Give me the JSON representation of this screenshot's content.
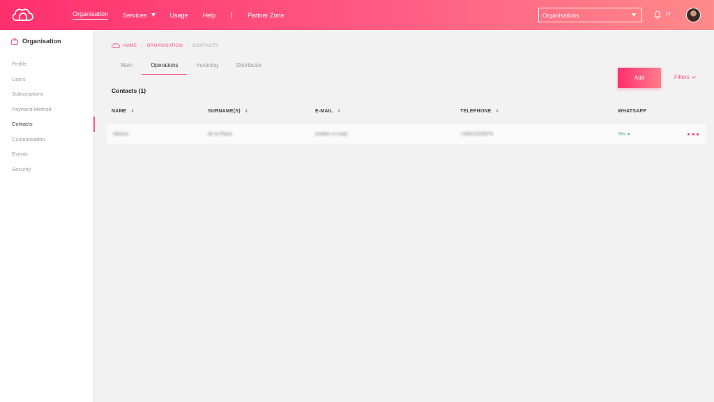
{
  "header": {
    "nav": [
      {
        "label": "Organisation",
        "active": true
      },
      {
        "label": "Services",
        "dropdown": true
      },
      {
        "label": "Usage"
      },
      {
        "label": "Help"
      },
      {
        "label": "Partner Zone"
      }
    ],
    "org_select": "Organisations",
    "notifications_count": "12"
  },
  "sidebar": {
    "title": "Organisation",
    "items": [
      "Profile",
      "Users",
      "Subscriptions",
      "Payment Method",
      "Contacts",
      "Customisation",
      "Events",
      "Security"
    ],
    "active_index": 4
  },
  "breadcrumb": {
    "home": "HOME",
    "section": "ORGANISATION",
    "current": "CONTACTS"
  },
  "tabs": [
    "Main",
    "Operations",
    "Invoicing",
    "Distributor"
  ],
  "active_tab": 1,
  "actions": {
    "add_label": "Add",
    "filters_label": "Filters"
  },
  "contacts": {
    "title": "Contacts (1)",
    "columns": [
      "NAME",
      "SURNAME(S)",
      "E-MAIL",
      "TELEPHONE",
      "WHATSAPP"
    ],
    "rows": [
      {
        "name": "Alberto",
        "surname": "de la Plaza",
        "email": "[hidden e-mail]",
        "telephone": "+34612345678",
        "whatsapp": "Yes"
      }
    ]
  },
  "colors": {
    "accent": "#ff4d7e",
    "header_start": "#ff2f6e",
    "header_end": "#ff8a8a",
    "success": "#3cb371"
  }
}
